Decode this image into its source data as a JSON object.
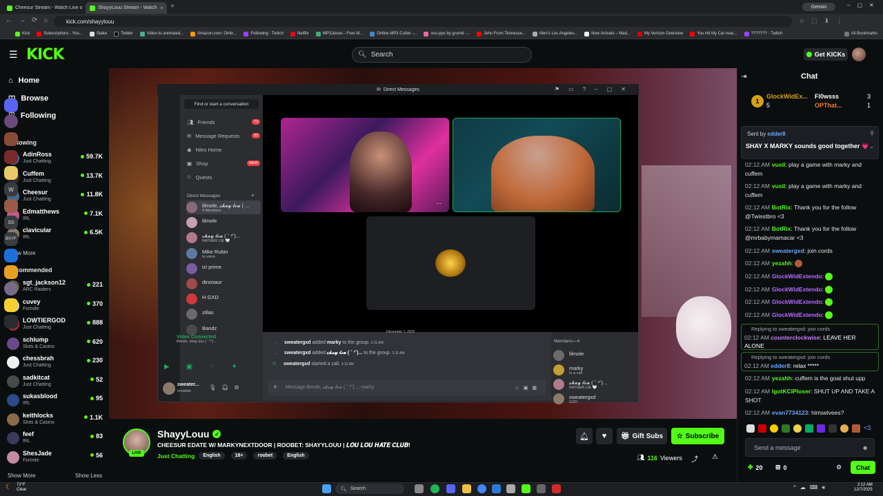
{
  "browser": {
    "tabs": [
      {
        "title": "Cheesur Stream - Watch Live o",
        "active": false
      },
      {
        "title": "ShayyLouu Stream - Watch",
        "active": true
      }
    ],
    "gemini_label": "Gemini",
    "url": "kick.com/shayylouu",
    "bookmarks": [
      "Kick",
      "Subscriptions - You...",
      "Stake",
      "Twitter",
      "Video to animated...",
      "Amazon.com: Onlin...",
      "Following - Twitch",
      "Netflix",
      "MP3Juices - Free M...",
      "Online MP3 Cutter -...",
      "osu-pps by grumd -...",
      "John From Tennesse...",
      "Men's Los Angeles...",
      "New Arrivals – Mad...",
      "My Verizon Overview",
      "You Hit My Car reac...",
      "??????? - Twitch"
    ],
    "all_bookmarks_label": "All Bookmarks"
  },
  "header": {
    "logo": "KICK",
    "search_placeholder": "Search",
    "get_kicks_label": "Get KICKs"
  },
  "sidebar": {
    "nav": [
      {
        "label": "Home",
        "icon": "home-icon"
      },
      {
        "label": "Browse",
        "icon": "browse-icon"
      },
      {
        "label": "Following",
        "icon": "heart-icon"
      }
    ],
    "following_title": "Following",
    "following": [
      {
        "name": "AdinRoss",
        "category": "Just Chatting",
        "viewers": "59.7K",
        "color": "#4a6fa5"
      },
      {
        "name": "Cuffem",
        "category": "Just Chatting",
        "viewers": "13.7K",
        "color": "#2f2f2f"
      },
      {
        "name": "Cheesur",
        "category": "Just Chatting",
        "viewers": "11.8K",
        "color": "#3d6b8c"
      },
      {
        "name": "Edmatthews",
        "category": "IRL",
        "viewers": "7.1K",
        "color": "#c05a8a"
      },
      {
        "name": "clavicular",
        "category": "IRL",
        "viewers": "6.5K",
        "color": "#8a7a6a"
      }
    ],
    "show_more_label": "Show More",
    "recommended_title": "Recommended",
    "recommended": [
      {
        "name": "sgt_jackson12",
        "category": "ARC Raiders",
        "viewers": "221",
        "color": "#5a5a3a"
      },
      {
        "name": "cuvey",
        "category": "Fortnite",
        "viewers": "370",
        "color": "#d9d9d9"
      },
      {
        "name": "LOWTIERGOD",
        "category": "Just Chatting",
        "viewers": "888",
        "color": "#9a2a2a"
      },
      {
        "name": "schlump",
        "category": "Slots & Casino",
        "viewers": "620",
        "color": "#6a4a8a"
      },
      {
        "name": "chessbrah",
        "category": "Just Chatting",
        "viewers": "230",
        "color": "#f0f0f0"
      },
      {
        "name": "sadkitcat",
        "category": "Just Chatting",
        "viewers": "52",
        "color": "#4a4a4a"
      },
      {
        "name": "sukasblood",
        "category": "IRL",
        "viewers": "95",
        "color": "#2a4a8a"
      },
      {
        "name": "keithlocks",
        "category": "Slots & Casino",
        "viewers": "1.1K",
        "color": "#8a6a4a"
      },
      {
        "name": "feef",
        "category": "IRL",
        "viewers": "83",
        "color": "#3a3a5a"
      },
      {
        "name": "ShesJade",
        "category": "Fortnite",
        "viewers": "56",
        "color": "#c48aa0"
      }
    ],
    "show_more_label_2": "Show More",
    "show_less_label": "Show Less"
  },
  "discord": {
    "title": "Direct Messages",
    "find_placeholder": "Find or start a conversation",
    "nav": [
      {
        "label": "Friends",
        "badge": "73"
      },
      {
        "label": "Message Requests",
        "badge": "33"
      },
      {
        "label": "Nitro Home",
        "badge": ""
      },
      {
        "label": "Shop",
        "badge": "NEW"
      },
      {
        "label": "Quests",
        "badge": ""
      }
    ],
    "dm_header": "Direct Messages",
    "dms": [
      {
        "name": "lilmole, 𝓼𝓱𝓪𝔂 𝓵𝓸𝓾 ( ...",
        "sub": "4 Members",
        "color": "#8a6a7a"
      },
      {
        "name": "lilmole",
        "sub": "",
        "color": "#c9a0b0"
      },
      {
        "name": "𝓼𝓱𝓪𝔂 𝓵𝓸𝓾 ( ˘ ³˘)...",
        "sub": "RATHER LIE 🤍",
        "color": "#b07a8a"
      },
      {
        "name": "Mike Rubin",
        "sub": "In voice",
        "color": "#5a7aa0"
      },
      {
        "name": "izi prime",
        "sub": "",
        "color": "#7a5aa0"
      },
      {
        "name": "dinosaur",
        "sub": "",
        "color": "#a04a4a"
      },
      {
        "name": "H GXD",
        "sub": "",
        "color": "#d03a3a"
      },
      {
        "name": "zillas",
        "sub": "",
        "color": "#6a6a6a"
      },
      {
        "name": "Bandz",
        "sub": "",
        "color": "#4a4a4a"
      }
    ],
    "video_connected": "Video Connected",
    "video_sub": "lilmole, shay lou ( ˘ ³˘)...",
    "user_name": "sweater...",
    "user_status": "Invisible",
    "date_divider": "December 1, 2025",
    "system_messages": [
      {
        "actor": "sweatergxd",
        "text1": "added",
        "target": "marky",
        "text2": "to the group.",
        "time": "2:11 AM"
      },
      {
        "actor": "sweatergxd",
        "text1": "added",
        "target": "𝓼𝓱𝓪𝔂 𝓵𝓸𝓾 ( ˘ ³˘)...",
        "text2": "to the group.",
        "time": "2:11 AM"
      },
      {
        "actor": "sweatergxd",
        "text1": "started a call.",
        "target": "",
        "text2": "",
        "time": "2:11 AM"
      }
    ],
    "input_placeholder": "Message lilmole, 𝓼𝓱𝓪𝔂 𝓵𝓸𝓾 ( ˘ ³˘)..., marky",
    "members_title": "Members—4",
    "members": [
      {
        "name": "lilmole",
        "sub": ""
      },
      {
        "name": "marky",
        "sub": "In a call"
      },
      {
        "name": "𝓼𝓱𝓪𝔂 𝓵𝓸𝓾 ( ˘ ³˘)...",
        "sub": "RATHER LIE 🤍"
      },
      {
        "name": "sweatergxd",
        "sub": "GXD"
      }
    ]
  },
  "stream": {
    "streamer": "ShayyLouu",
    "live_label": "LIVE",
    "title": "CHEESUR EDATE W/ MARKYNEXTDOOR | ROOBET: SHAYYLOUU | 𝑳𝑶𝑼 𝑳𝑶𝑼 𝑯𝑨𝑻𝑬 𝑪𝑳𝑼𝑩!",
    "category": "Just Chatting",
    "tags": [
      "English",
      "18+",
      "roobet",
      "English"
    ],
    "gift_subs_label": "Gift Subs",
    "subscribe_label": "Subscribe",
    "viewers": "116",
    "viewers_label": "Viewers"
  },
  "chat": {
    "title": "Chat",
    "leaderboard": [
      {
        "name": "GlockWidEx...",
        "value": "5",
        "rank": "1"
      },
      {
        "name": "Fl0wsss",
        "value": "3"
      },
      {
        "name": "OPThat...",
        "value": "1"
      }
    ],
    "pinned": {
      "sent_by": "Sent by",
      "sender": "edder8",
      "text": "SHAY X MARKY sounds good together 💗"
    },
    "messages": [
      {
        "time": "02:12 AM",
        "user": "vusil",
        "color": "#53fc18",
        "text": "play a game with marky and cuffem"
      },
      {
        "time": "02:12 AM",
        "user": "vusil",
        "color": "#53fc18",
        "text": "play a game with marky and cuffem"
      },
      {
        "time": "02:12 AM",
        "user": "BotRix",
        "color": "#53fc18",
        "text": "Thank you for the follow @Twisstbro <3"
      },
      {
        "time": "02:12 AM",
        "user": "BotRix",
        "color": "#53fc18",
        "text": "Thank you for the follow @mrbabymamacar <3"
      },
      {
        "time": "02:12 AM",
        "user": "sweatergxd",
        "color": "#6ba6ff",
        "text": "join cords"
      },
      {
        "time": "02:12 AM",
        "user": "yezahh",
        "color": "#53fc18",
        "text": ""
      },
      {
        "time": "02:12 AM",
        "user": "GlockWidExtendo",
        "color": "#b56cff",
        "text": ""
      },
      {
        "time": "02:12 AM",
        "user": "GlockWidExtendo",
        "color": "#b56cff",
        "text": ""
      },
      {
        "time": "02:12 AM",
        "user": "GlockWidExtendo",
        "color": "#b56cff",
        "text": ""
      },
      {
        "time": "02:12 AM",
        "user": "GlockWidExtendo",
        "color": "#b56cff",
        "text": ""
      }
    ],
    "reply1": {
      "label": "Replying to sweatergxd: join cords",
      "time": "02:12 AM",
      "user": "counterclockwise",
      "color": "#c77dff",
      "text": "LEAVE HER ALONE"
    },
    "reply2": {
      "label": "Replying to sweatergxd: join cords",
      "time": "02:12 AM",
      "user": "edder8",
      "color": "#6ba6ff",
      "text": "relax *****"
    },
    "messages2": [
      {
        "time": "02:12 AM",
        "user": "yezahh",
        "color": "#53fc18",
        "text": "cuffem is the goat shut upp"
      },
      {
        "time": "02:12 AM",
        "user": "IgotKCIPloser",
        "color": "#53fc18",
        "text": "SHUT UP AND TAKE A SHOT"
      },
      {
        "time": "02:12 AM",
        "user": "evan7734123",
        "color": "#6ba6ff",
        "text": "himselvees?"
      }
    ],
    "send_placeholder": "Send a message",
    "kicks_count": "20",
    "gift_count": "0",
    "chat_button": "Chat"
  },
  "taskbar": {
    "weather_temp": "72°F",
    "weather_desc": "Clear",
    "search_label": "Search",
    "time": "2:12 AM",
    "date": "12/7/2025"
  },
  "colors": {
    "kick_green": "#53fc18",
    "bg": "#0b0e0f",
    "discord_bg": "#1e1f22"
  }
}
